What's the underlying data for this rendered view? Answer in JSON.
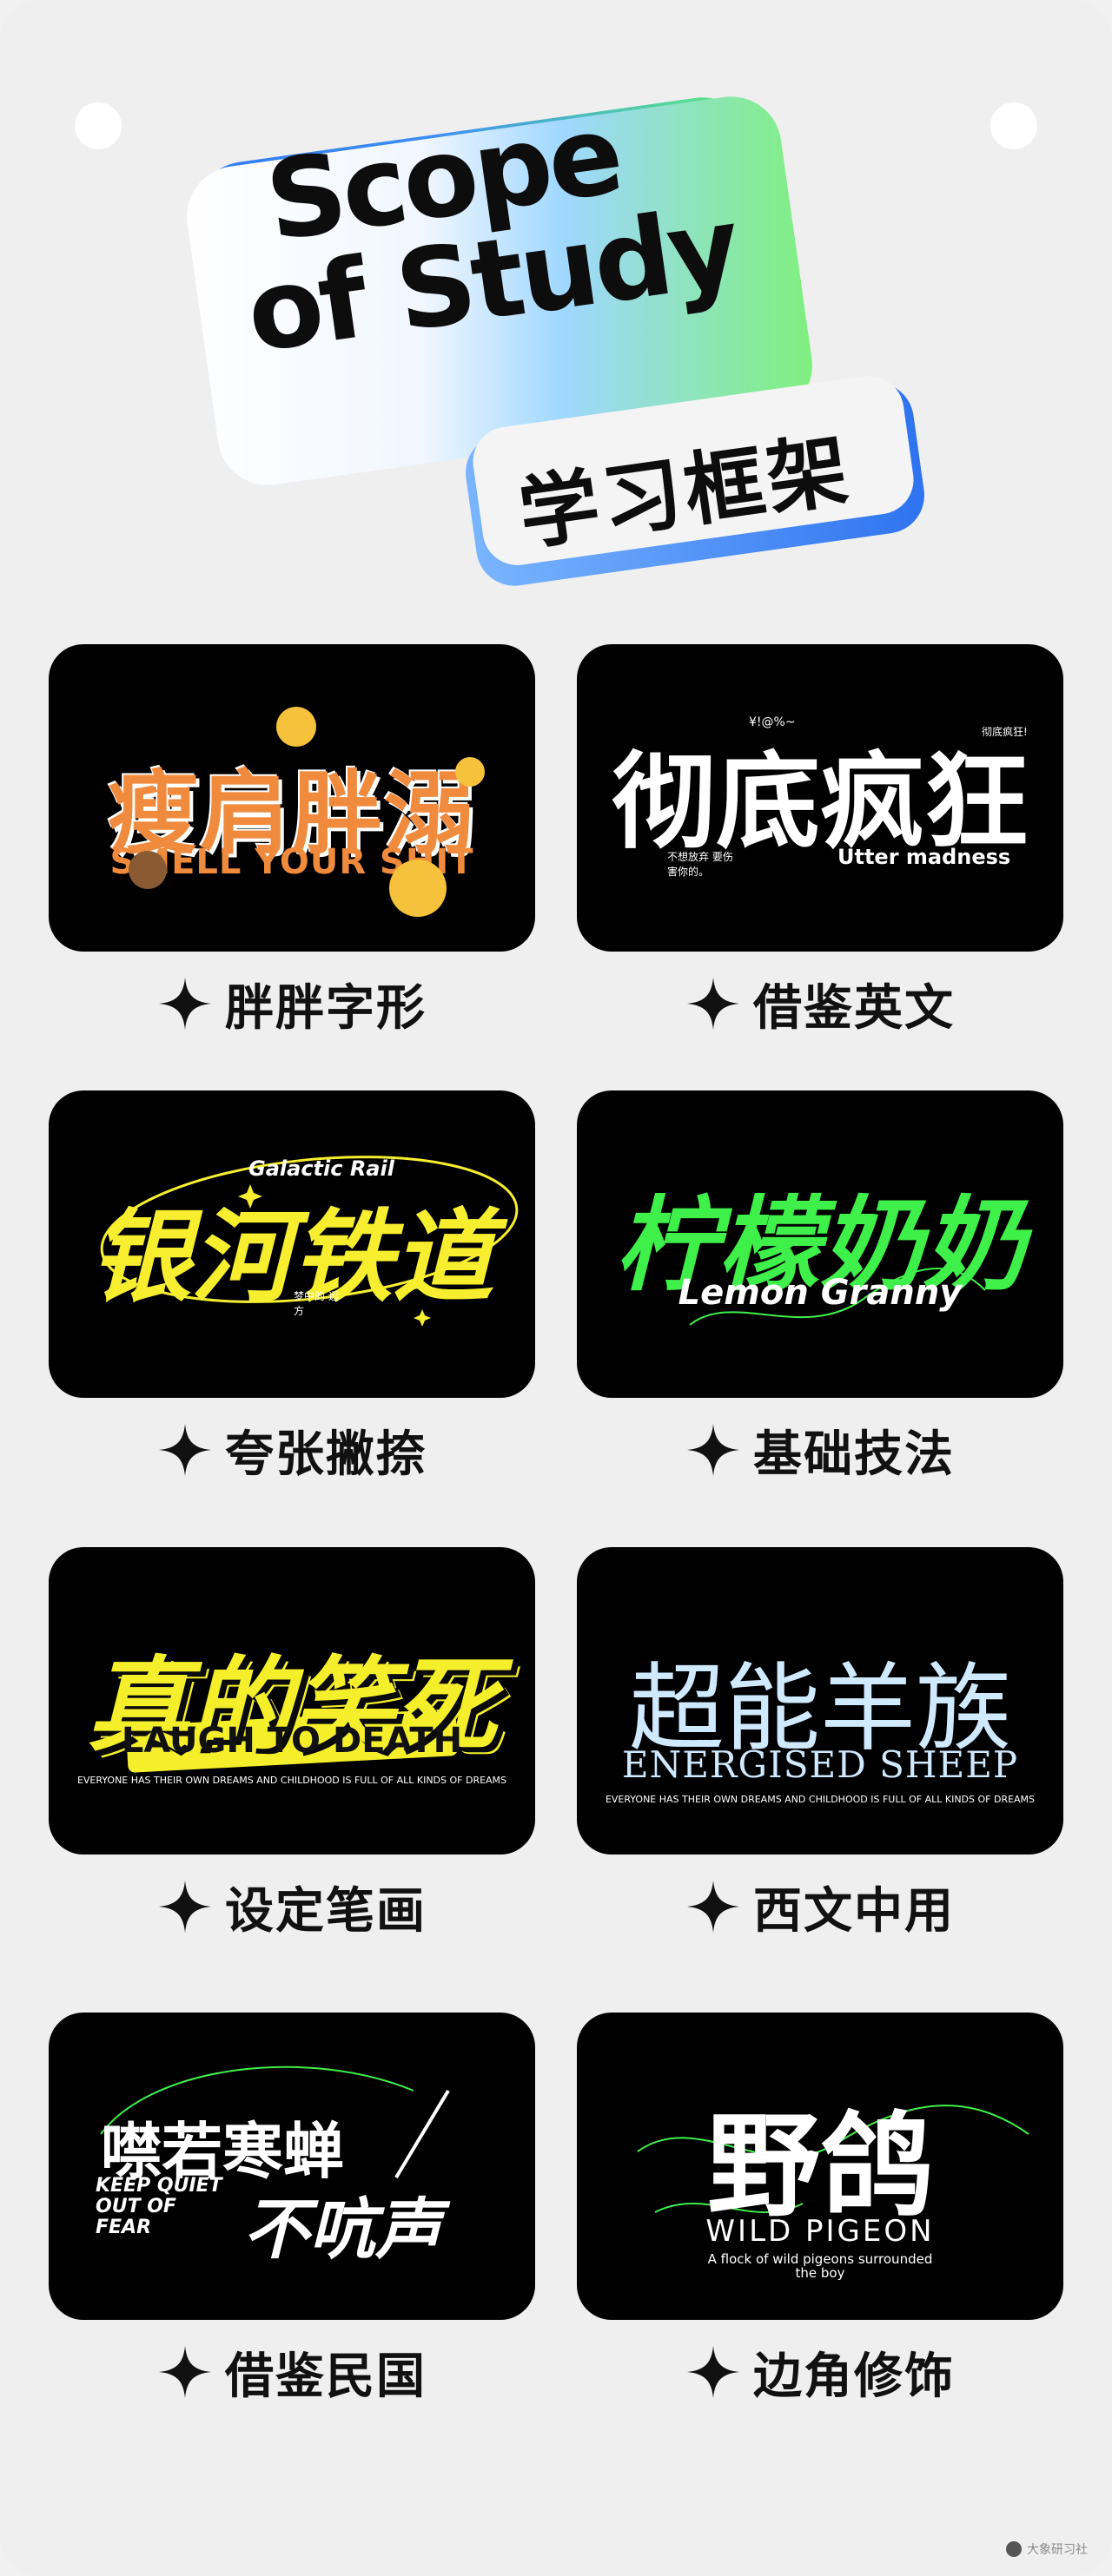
{
  "title": {
    "en_line1": "Scope",
    "en_line2": "of Study",
    "zh": "学习框架"
  },
  "cards": [
    {
      "art_main": "瘦肩胖溺",
      "art_en": "SMELL YOUR SHIT",
      "label": "胖胖字形"
    },
    {
      "art_main": "彻底疯狂",
      "art_en": "Utter madness",
      "tiny_a": "¥!@%~",
      "tiny_b": "不想放弃 要伤害你的。",
      "tiny_c": "彻底疯狂!",
      "label": "借鉴英文"
    },
    {
      "art_main": "银河铁道",
      "art_en": "Galactic Rail",
      "tiny_a": "梦中的 远方",
      "label": "夸张撇捺"
    },
    {
      "art_main": "柠檬奶奶",
      "art_en": "Lemon Granny",
      "label": "基础技法"
    },
    {
      "art_main": "真的笑死",
      "art_en": "LAUGH TO DEATH",
      "sub": "EVERYONE HAS THEIR OWN DREAMS AND CHILDHOOD IS FULL OF ALL KINDS OF DREAMS",
      "label": "设定笔画"
    },
    {
      "art_main": "超能羊族",
      "art_en": "ENERGISED SHEEP",
      "sub": "EVERYONE HAS THEIR OWN DREAMS AND CHILDHOOD IS FULL OF ALL KINDS OF DREAMS",
      "label": "西文中用"
    },
    {
      "art_main": "噤若寒蝉",
      "art_main2": "不吭声",
      "art_en": "KEEP QUIET OUT OF FEAR",
      "label": "借鉴民国"
    },
    {
      "art_main": "野鸽",
      "art_en": "WILD PIGEON",
      "sub": "A flock of wild pigeons surrounded the boy",
      "label": "边角修饰"
    }
  ],
  "watermark": "大象研习社",
  "colors": {
    "background": "#efefef",
    "card": "#000000",
    "gradient_blue": "#2f7bf1",
    "gradient_green": "#6ef07d",
    "orange": "#f08a3c",
    "yellow": "#f6ee2e",
    "green": "#3ff04a",
    "light_blue": "#cfe9ff"
  },
  "icons": [
    "four-point-star-icon"
  ]
}
